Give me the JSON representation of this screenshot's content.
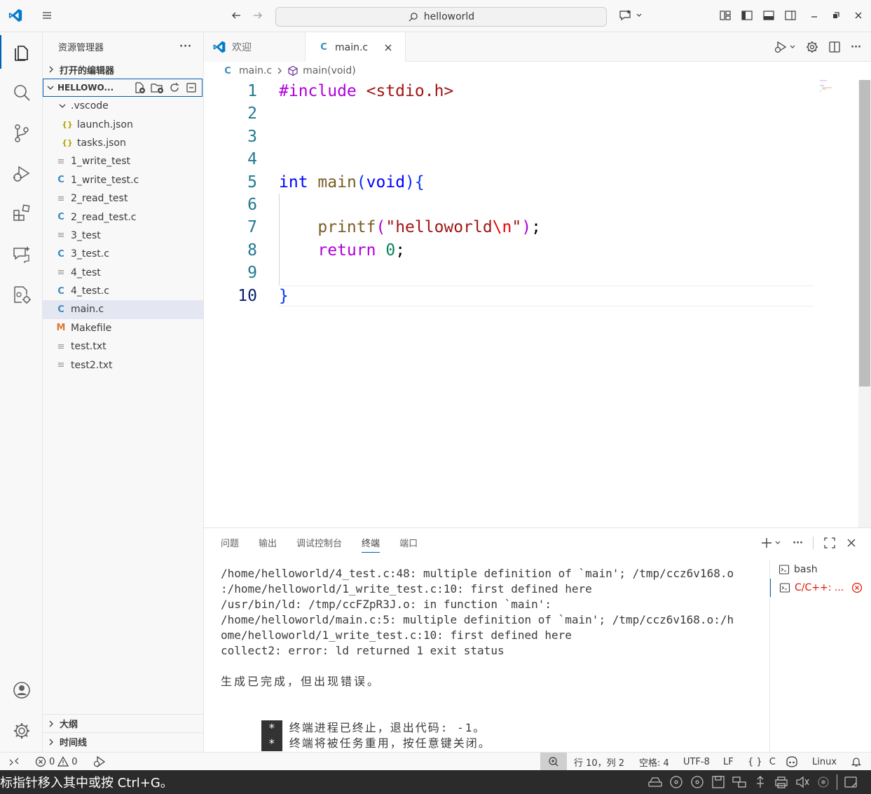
{
  "titlebar": {
    "search_text": "helloworld"
  },
  "sidebar": {
    "title": "资源管理器",
    "open_editors": "打开的编辑器",
    "workspace": "HELLOWO...",
    "files": [
      {
        "name": ".vscode",
        "kind": "folder"
      },
      {
        "name": "launch.json",
        "kind": "json"
      },
      {
        "name": "tasks.json",
        "kind": "json"
      },
      {
        "name": "1_write_test",
        "kind": "txt"
      },
      {
        "name": "1_write_test.c",
        "kind": "c"
      },
      {
        "name": "2_read_test",
        "kind": "txt"
      },
      {
        "name": "2_read_test.c",
        "kind": "c"
      },
      {
        "name": "3_test",
        "kind": "txt"
      },
      {
        "name": "3_test.c",
        "kind": "c"
      },
      {
        "name": "4_test",
        "kind": "txt"
      },
      {
        "name": "4_test.c",
        "kind": "c"
      },
      {
        "name": "main.c",
        "kind": "c"
      },
      {
        "name": "Makefile",
        "kind": "mk"
      },
      {
        "name": "test.txt",
        "kind": "txt"
      },
      {
        "name": "test2.txt",
        "kind": "txt"
      }
    ],
    "outline": "大纲",
    "timeline": "时间线"
  },
  "tabs": {
    "welcome": "欢迎",
    "main": "main.c"
  },
  "breadcrumb": {
    "file": "main.c",
    "symbol": "main(void)"
  },
  "editor": {
    "line_numbers": [
      "1",
      "2",
      "3",
      "4",
      "5",
      "6",
      "7",
      "8",
      "9",
      "10"
    ]
  },
  "panel": {
    "tabs": [
      "问题",
      "输出",
      "调试控制台",
      "终端",
      "端口"
    ],
    "terminal_lines": [
      "/home/helloworld/4_test.c:48: multiple definition of `main'; /tmp/ccz6v168.o",
      ":/home/helloworld/1_write_test.c:10: first defined here",
      "/usr/bin/ld: /tmp/ccFZpR3J.o: in function `main':",
      "/home/helloworld/main.c:5: multiple definition of `main'; /tmp/ccz6v168.o:/h",
      "ome/helloworld/1_write_test.c:10: first defined here",
      "collect2: error: ld returned 1 exit status",
      "",
      "生成已完成，但出现错误。",
      ""
    ],
    "terminal_notes": [
      "终端进程已终止，退出代码: -1。",
      "终端将被任务重用，按任意键关闭。"
    ],
    "terminal_mark": "*",
    "terminals": [
      "bash",
      "C/C++: ..."
    ]
  },
  "statusbar": {
    "errors": "0",
    "warnings": "0",
    "position": "行 10，列 2",
    "spaces": "空格: 4",
    "encoding": "UTF-8",
    "eol": "LF",
    "language": "C",
    "platform": "Linux"
  },
  "os": {
    "message": "标指针移入其中或按 Ctrl+G。"
  }
}
